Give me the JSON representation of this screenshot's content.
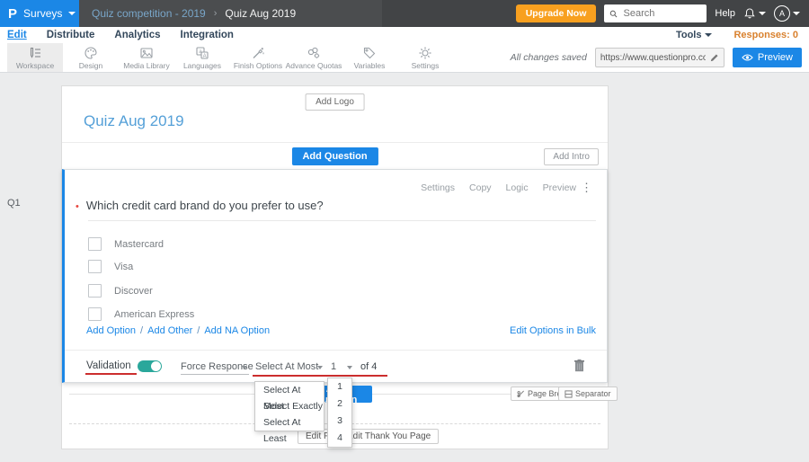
{
  "topbar": {
    "logo_letter": "P",
    "product_label": "Surveys",
    "breadcrumb": {
      "parent": "Quiz competition - 2019",
      "separator": "›",
      "current": "Quiz Aug 2019"
    },
    "upgrade_label": "Upgrade Now",
    "search_placeholder": "Search",
    "help_label": "Help",
    "avatar_letter": "A"
  },
  "nav": {
    "items": [
      {
        "label": "Edit"
      },
      {
        "label": "Distribute"
      },
      {
        "label": "Analytics"
      },
      {
        "label": "Integration"
      }
    ],
    "tools_label": "Tools",
    "responses_label": "Responses: 0"
  },
  "toolbar": {
    "items": [
      {
        "label": "Workspace"
      },
      {
        "label": "Design"
      },
      {
        "label": "Media Library"
      },
      {
        "label": "Languages"
      },
      {
        "label": "Finish Options"
      },
      {
        "label": "Advance Quotas"
      },
      {
        "label": "Variables"
      },
      {
        "label": "Settings"
      }
    ],
    "saved_status": "All changes saved",
    "survey_url": "https://www.questionpro.com/t/APNrFZ",
    "preview_label": "Preview"
  },
  "survey": {
    "add_logo_label": "Add Logo",
    "title": "Quiz Aug 2019",
    "add_question_label": "Add Question",
    "add_intro_label": "Add Intro",
    "question": {
      "id_label": "Q1",
      "actions": [
        {
          "label": "Settings"
        },
        {
          "label": "Copy"
        },
        {
          "label": "Logic"
        },
        {
          "label": "Preview"
        }
      ],
      "kebab_glyph": "⋮",
      "required_mark": "•",
      "text": "Which credit card brand do you prefer to use?",
      "options": [
        {
          "label": "Mastercard"
        },
        {
          "label": "Visa"
        },
        {
          "label": "Discover"
        },
        {
          "label": "American Express"
        }
      ],
      "add_links": [
        {
          "label": "Add Option"
        },
        {
          "label": "Add Other"
        },
        {
          "label": "Add NA Option"
        }
      ],
      "link_separator": "/",
      "bulk_edit_label": "Edit Options in Bulk",
      "validation": {
        "label": "Validation",
        "force_response_label": "Force Response",
        "rule_value": "Select At Most",
        "count_value": "1",
        "of_label": "of 4"
      }
    },
    "add_question2_label": "Add Question",
    "page_break_label": "Page Break",
    "separator_label": "Separator",
    "edit_footer_label": "Edit Footer",
    "edit_thankyou_label": "Edit Thank You Page"
  },
  "dropdowns": {
    "rule_options": [
      {
        "label": "Select At Most"
      },
      {
        "label": "Select Exactly"
      },
      {
        "label": "Select At Least"
      }
    ],
    "number_options": [
      {
        "label": "1"
      },
      {
        "label": "2"
      },
      {
        "label": "3"
      },
      {
        "label": "4"
      }
    ]
  },
  "colors": {
    "brand_blue": "#1b87e6",
    "upgrade_orange": "#f8a01f",
    "toggle_teal": "#2aa79b",
    "annotation_red": "#cc2e2e",
    "responses_orange": "#d9812e",
    "title_blue": "#55a0d8"
  }
}
